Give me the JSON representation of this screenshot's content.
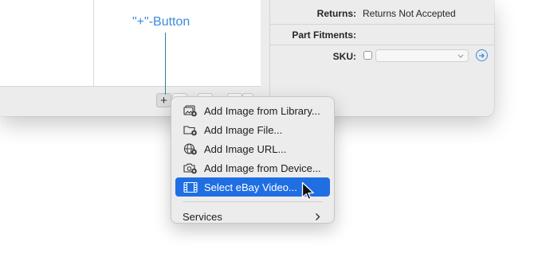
{
  "callout": {
    "label": "\"+\"-Button"
  },
  "toolbar": {
    "plus_label": "+",
    "minus_label": "−"
  },
  "fields": {
    "returns": {
      "label": "Returns:",
      "value": "Returns Not Accepted"
    },
    "part_fitments": {
      "label": "Part Fitments:"
    },
    "sku": {
      "label": "SKU:",
      "checked": false,
      "value": ""
    }
  },
  "menu": {
    "items": [
      {
        "label": "Add Image from Library...",
        "icon": "photo-library-icon"
      },
      {
        "label": "Add Image File...",
        "icon": "folder-add-icon"
      },
      {
        "label": "Add Image URL...",
        "icon": "globe-add-icon"
      },
      {
        "label": "Add Image from Device...",
        "icon": "camera-add-icon"
      },
      {
        "label": "Select eBay Video...",
        "icon": "film-strip-icon",
        "highlighted": true
      }
    ],
    "services_label": "Services"
  },
  "colors": {
    "accent": "#1f6fe3",
    "callout": "#3c8bdc"
  }
}
